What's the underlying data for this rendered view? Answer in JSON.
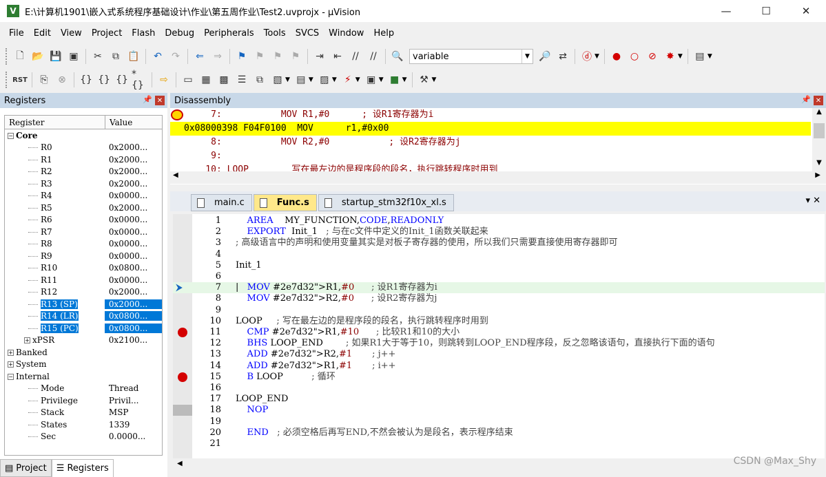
{
  "window": {
    "title": "E:\\计算机1901\\嵌入式系统程序基础设计\\作业\\第五周作业\\Test2.uvprojx - µVision",
    "app_icon_letter": "V",
    "minimize": "—",
    "maximize": "☐",
    "close": "✕"
  },
  "menu": [
    "File",
    "Edit",
    "View",
    "Project",
    "Flash",
    "Debug",
    "Peripherals",
    "Tools",
    "SVCS",
    "Window",
    "Help"
  ],
  "toolbar": {
    "find_combo_value": "variable"
  },
  "registers_panel": {
    "title": "Registers",
    "col_register": "Register",
    "col_value": "Value",
    "rows": [
      {
        "indent": 0,
        "toggle": "−",
        "name": "Core",
        "value": "",
        "bold": true
      },
      {
        "indent": 1,
        "name": "R0",
        "value": "0x2000..."
      },
      {
        "indent": 1,
        "name": "R1",
        "value": "0x2000..."
      },
      {
        "indent": 1,
        "name": "R2",
        "value": "0x2000..."
      },
      {
        "indent": 1,
        "name": "R3",
        "value": "0x2000..."
      },
      {
        "indent": 1,
        "name": "R4",
        "value": "0x0000..."
      },
      {
        "indent": 1,
        "name": "R5",
        "value": "0x2000..."
      },
      {
        "indent": 1,
        "name": "R6",
        "value": "0x0000..."
      },
      {
        "indent": 1,
        "name": "R7",
        "value": "0x0000..."
      },
      {
        "indent": 1,
        "name": "R8",
        "value": "0x0000..."
      },
      {
        "indent": 1,
        "name": "R9",
        "value": "0x0000..."
      },
      {
        "indent": 1,
        "name": "R10",
        "value": "0x0800..."
      },
      {
        "indent": 1,
        "name": "R11",
        "value": "0x0000..."
      },
      {
        "indent": 1,
        "name": "R12",
        "value": "0x2000..."
      },
      {
        "indent": 1,
        "name": "R13 (SP)",
        "value": "0x2000...",
        "selected": true
      },
      {
        "indent": 1,
        "name": "R14 (LR)",
        "value": "0x0800...",
        "selected": true
      },
      {
        "indent": 1,
        "name": "R15 (PC)",
        "value": "0x0800...",
        "selected": true
      },
      {
        "indent": 1,
        "toggle": "+",
        "name": "xPSR",
        "value": "0x2100..."
      },
      {
        "indent": 0,
        "toggle": "+",
        "name": "Banked",
        "value": ""
      },
      {
        "indent": 0,
        "toggle": "+",
        "name": "System",
        "value": ""
      },
      {
        "indent": 0,
        "toggle": "−",
        "name": "Internal",
        "value": ""
      },
      {
        "indent": 1,
        "name": "Mode",
        "value": "Thread"
      },
      {
        "indent": 1,
        "name": "Privilege",
        "value": "Privil..."
      },
      {
        "indent": 1,
        "name": "Stack",
        "value": "MSP"
      },
      {
        "indent": 1,
        "name": "States",
        "value": "1339"
      },
      {
        "indent": 1,
        "name": "Sec",
        "value": "0.0000..."
      }
    ],
    "tab_project": "Project",
    "tab_registers": "Registers"
  },
  "disassembly": {
    "title": "Disassembly",
    "lines": [
      {
        "text": "     7:           MOV R1,#0      ; 设R1寄存器为i",
        "current": false
      },
      {
        "text": "0x08000398 F04F0100  MOV      r1,#0x00",
        "current": true
      },
      {
        "text": "     8:           MOV R2,#0           ; 设R2寄存器为j",
        "current": false
      },
      {
        "text": "     9:",
        "current": false
      },
      {
        "text": "    10: LOOP        写在最左边的是程序段的段名，执行跳转程序时用到",
        "current": false
      }
    ]
  },
  "editor": {
    "tabs": [
      {
        "label": "main.c",
        "active": false
      },
      {
        "label": "Func.s",
        "active": true
      },
      {
        "label": "startup_stm32f10x_xl.s",
        "active": false
      }
    ],
    "controls": "▾  ✕",
    "lines": [
      {
        "n": "1",
        "code": "    AREA    MY_FUNCTION,CODE,READONLY"
      },
      {
        "n": "2",
        "code": "    EXPORT  Init_1   ; 与在c文件中定义的Init_1函数关联起来"
      },
      {
        "n": "3",
        "code": "; 高级语言中的声明和使用变量其实是对板子寄存器的使用，所以我们只需要直接使用寄存器即可"
      },
      {
        "n": "4",
        "code": ""
      },
      {
        "n": "5",
        "code": "Init_1"
      },
      {
        "n": "6",
        "code": ""
      },
      {
        "n": "7",
        "code": "|   MOV R1,#0      ; 设R1寄存器为i",
        "highlight": true,
        "pc": true
      },
      {
        "n": "8",
        "code": "    MOV R2,#0      ; 设R2寄存器为j"
      },
      {
        "n": "9",
        "code": ""
      },
      {
        "n": "10",
        "code": "LOOP     ; 写在最左边的是程序段的段名，执行跳转程序时用到"
      },
      {
        "n": "11",
        "code": "    CMP R1,#10      ; 比较R1和10的大小",
        "bp": true
      },
      {
        "n": "12",
        "code": "    BHS LOOP_END        ; 如果R1大于等于10，则跳转到LOOP_END程序段，反之忽略该语句，直接执行下面的语句"
      },
      {
        "n": "13",
        "code": "    ADD R2,#1       ; j++"
      },
      {
        "n": "14",
        "code": "    ADD R1,#1       ; i++"
      },
      {
        "n": "15",
        "code": "    B LOOP          ; 循环",
        "bp": true
      },
      {
        "n": "16",
        "code": ""
      },
      {
        "n": "17",
        "code": "LOOP_END"
      },
      {
        "n": "18",
        "code": "    NOP",
        "gmark": true
      },
      {
        "n": "19",
        "code": ""
      },
      {
        "n": "20",
        "code": "    END   ; 必须空格后再写END,不然会被认为是段名，表示程序结束"
      },
      {
        "n": "21",
        "code": ""
      }
    ]
  },
  "watermark": "CSDN @Max_Shy"
}
